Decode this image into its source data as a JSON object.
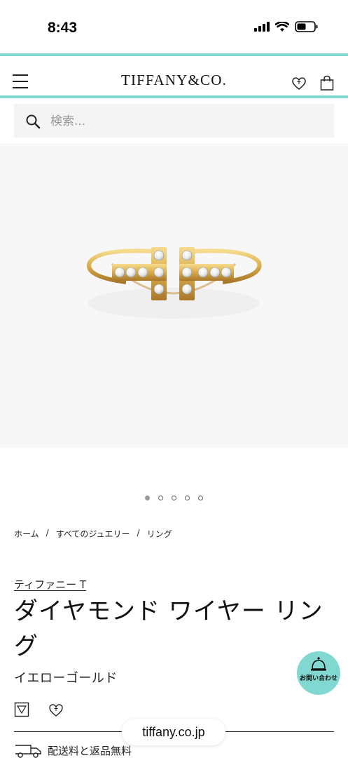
{
  "status_bar": {
    "time": "8:43"
  },
  "header": {
    "brand": "TIFFANY&CO."
  },
  "search": {
    "placeholder": "検索..."
  },
  "carousel": {
    "total": 5,
    "active": 1
  },
  "breadcrumb": {
    "items": [
      "ホーム",
      "すべてのジュエリー",
      "リング"
    ],
    "separator": "/"
  },
  "product": {
    "collection": "ティファニー T",
    "title": "ダイヤモンド ワイヤー リング",
    "subtitle": "イエローゴールド"
  },
  "browser": {
    "url": "tiffany.co.jp"
  },
  "shipping": {
    "label": "配送料と返品無料"
  },
  "contact": {
    "label": "お問い合わせ"
  },
  "colors": {
    "accent": "#81d8d0",
    "text": "#111111",
    "search_bg": "#f4f4f4",
    "image_bg": "#f7f7f7"
  },
  "icons": [
    "signal-icon",
    "wifi-icon",
    "battery-icon",
    "menu-icon",
    "heart-icon",
    "shopping-bag-icon",
    "search-icon",
    "ring-size-icon",
    "truck-icon",
    "bell-icon"
  ]
}
